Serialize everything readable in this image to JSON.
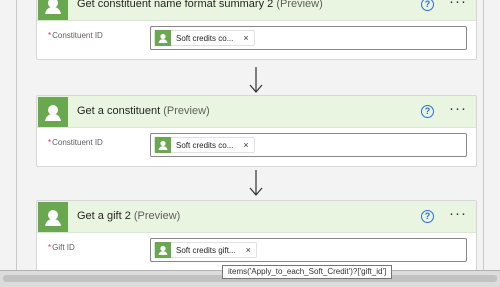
{
  "cards": [
    {
      "title": "Get constituent name format summary 2",
      "preview": "(Preview)",
      "field_label": "Constituent ID",
      "required_mark": "*",
      "token_text": "Soft credits co...",
      "token_remove": "×",
      "help_glyph": "?",
      "more_glyph": "···"
    },
    {
      "title": "Get a constituent",
      "preview": "(Preview)",
      "field_label": "Constituent ID",
      "required_mark": "*",
      "token_text": "Soft credits co...",
      "token_remove": "×",
      "help_glyph": "?",
      "more_glyph": "···"
    },
    {
      "title": "Get a gift 2",
      "preview": "(Preview)",
      "field_label": "Gift ID",
      "required_mark": "*",
      "token_text": "Soft credits gift...",
      "token_remove": "×",
      "help_glyph": "?",
      "more_glyph": "···"
    }
  ],
  "tooltip": {
    "text": "items('Apply_to_each_Soft_Credit')?['gift_id']"
  },
  "icons": {
    "card_icon": "blackbaud-connector-icon",
    "token_icon": "blackbaud-connector-icon",
    "arrow": "arrow-down-icon"
  },
  "colors": {
    "connector_green": "#6aa84f",
    "header_bg": "#eaf5e1",
    "help_blue": "#2b6bd6",
    "required_red": "#d13438"
  }
}
